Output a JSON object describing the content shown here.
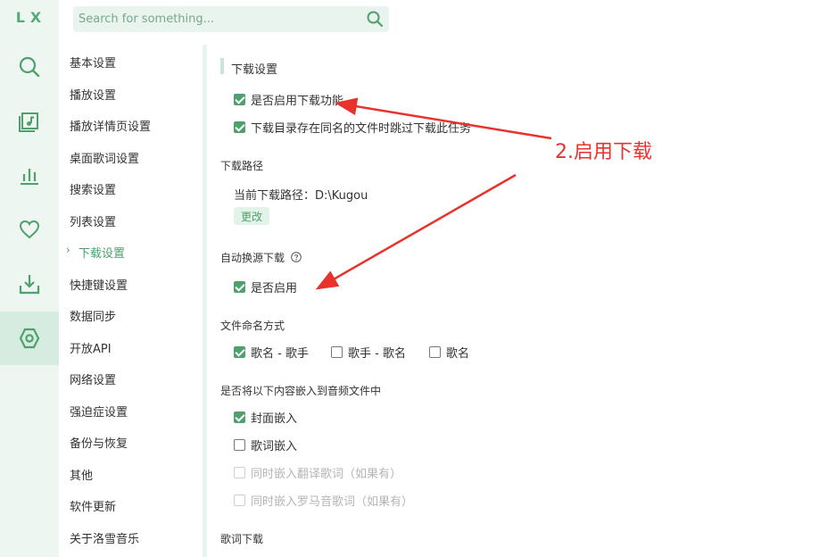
{
  "app": {
    "logo": "LX"
  },
  "search": {
    "placeholder": "Search for something..."
  },
  "rail": {
    "items": [
      {
        "icon": "search-icon"
      },
      {
        "icon": "music-library-icon"
      },
      {
        "icon": "chart-icon"
      },
      {
        "icon": "heart-icon"
      },
      {
        "icon": "download-icon"
      },
      {
        "icon": "settings-icon",
        "active": true
      }
    ]
  },
  "nav": {
    "items": [
      {
        "label": "基本设置"
      },
      {
        "label": "播放设置"
      },
      {
        "label": "播放详情页设置"
      },
      {
        "label": "桌面歌词设置"
      },
      {
        "label": "搜索设置"
      },
      {
        "label": "列表设置"
      },
      {
        "label": "下载设置",
        "active": true
      },
      {
        "label": "快捷键设置"
      },
      {
        "label": "数据同步"
      },
      {
        "label": "开放API"
      },
      {
        "label": "网络设置"
      },
      {
        "label": "强迫症设置"
      },
      {
        "label": "备份与恢复"
      },
      {
        "label": "其他"
      },
      {
        "label": "软件更新"
      },
      {
        "label": "关于洛雪音乐"
      }
    ]
  },
  "download": {
    "title": "下载设置",
    "enable": {
      "label": "是否启用下载功能",
      "checked": true
    },
    "skip_existing": {
      "label": "下载目录存在同名的文件时跳过下载此任务",
      "checked": true
    },
    "path": {
      "title": "下载路径",
      "current": "当前下载路径：D:\\Kugou",
      "change_label": "更改"
    },
    "auto_switch": {
      "title": "自动换源下载",
      "enable": {
        "label": "是否启用",
        "checked": true
      }
    },
    "naming": {
      "title": "文件命名方式",
      "options": [
        {
          "label": "歌名 - 歌手",
          "checked": true
        },
        {
          "label": "歌手 - 歌名",
          "checked": false
        },
        {
          "label": "歌名",
          "checked": false
        }
      ]
    },
    "embed": {
      "title": "是否将以下内容嵌入到音频文件中",
      "cover": {
        "label": "封面嵌入",
        "checked": true
      },
      "lyrics": {
        "label": "歌词嵌入",
        "checked": false
      },
      "translated": {
        "label": "同时嵌入翻译歌词（如果有）",
        "checked": false,
        "disabled": true
      },
      "romaji": {
        "label": "同时嵌入罗马音歌词（如果有）",
        "checked": false,
        "disabled": true
      }
    },
    "lyrics_download": {
      "title": "歌词下载"
    }
  },
  "annotation": {
    "text": "2.启用下载",
    "color": "#e8332d"
  },
  "colors": {
    "accent": "#4fa06d",
    "rail_bg": "#edf6f0",
    "rail_active": "#d6ece0"
  }
}
